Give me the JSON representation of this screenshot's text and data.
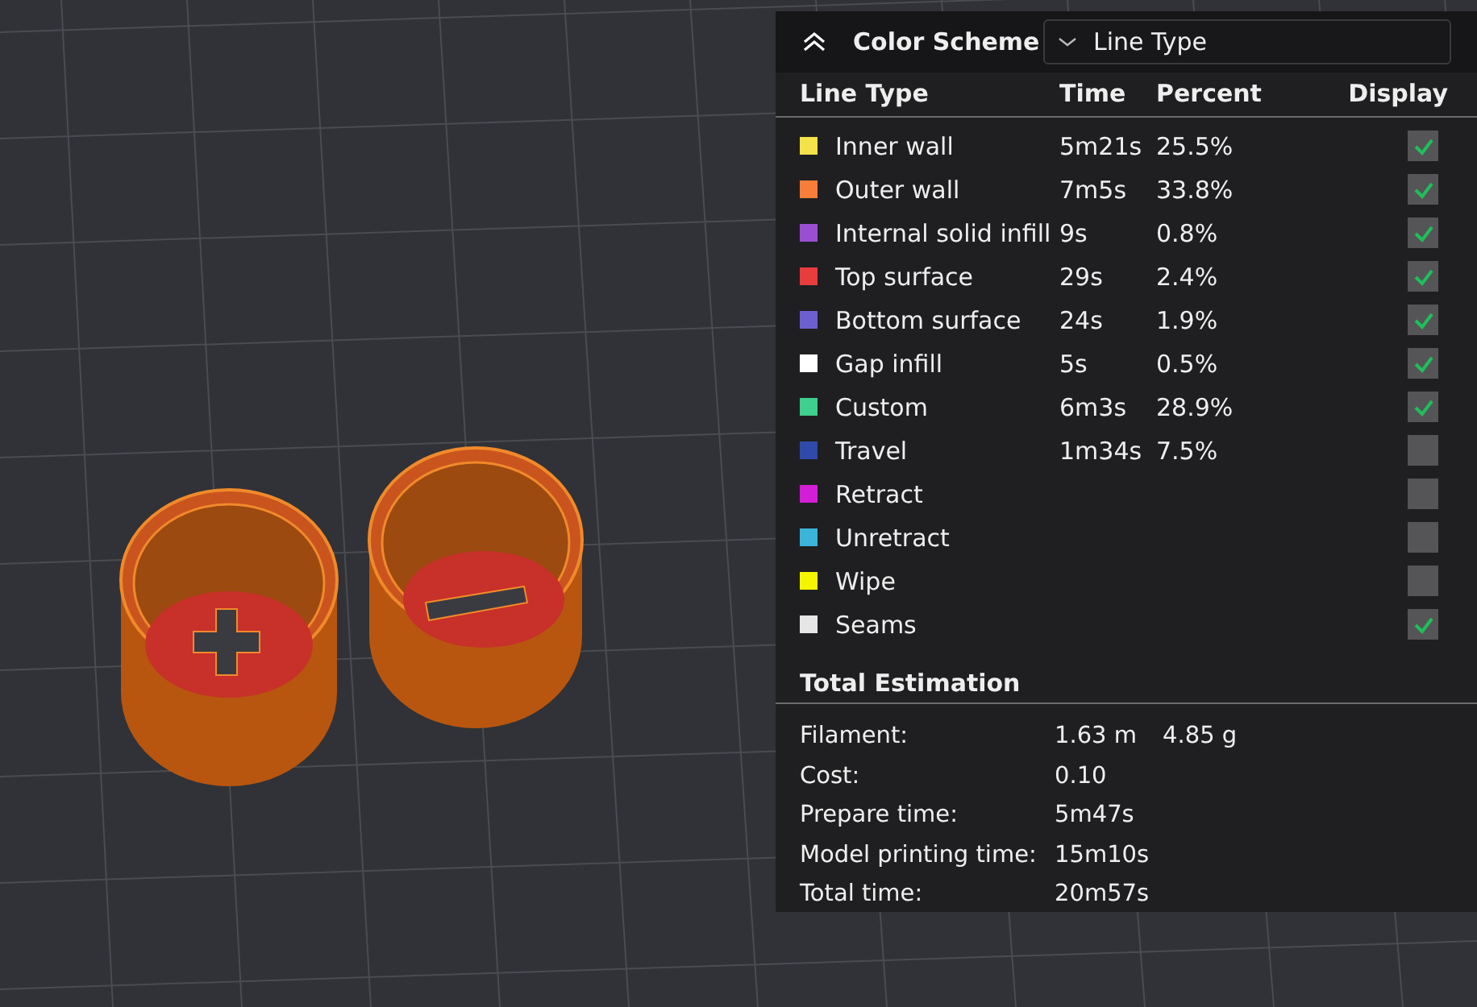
{
  "legend": {
    "title": "Color Scheme",
    "scheme_dropdown": {
      "value": "Line Type"
    },
    "columns": [
      "Line Type",
      "Time",
      "Percent",
      "Display"
    ],
    "rows": [
      {
        "name": "Inner wall",
        "time": "5m21s",
        "percent": "25.5%",
        "color": "#f5e14a",
        "checked": true
      },
      {
        "name": "Outer wall",
        "time": "7m5s",
        "percent": "33.8%",
        "color": "#f47e3a",
        "checked": true
      },
      {
        "name": "Internal solid infill",
        "time": "9s",
        "percent": "0.8%",
        "color": "#9a4fd0",
        "checked": true
      },
      {
        "name": "Top surface",
        "time": "29s",
        "percent": "2.4%",
        "color": "#e83d3d",
        "checked": true
      },
      {
        "name": "Bottom surface",
        "time": "24s",
        "percent": "1.9%",
        "color": "#6d5fd0",
        "checked": true
      },
      {
        "name": "Gap infill",
        "time": "5s",
        "percent": "0.5%",
        "color": "#ffffff",
        "checked": true
      },
      {
        "name": "Custom",
        "time": "6m3s",
        "percent": "28.9%",
        "color": "#3fcf8e",
        "checked": true
      },
      {
        "name": "Travel",
        "time": "1m34s",
        "percent": "7.5%",
        "color": "#2f4aa8",
        "checked": false
      },
      {
        "name": "Retract",
        "color": "#d21fd6",
        "checked": false
      },
      {
        "name": "Unretract",
        "color": "#3cb4d8",
        "checked": false
      },
      {
        "name": "Wipe",
        "color": "#f5f500",
        "checked": false
      },
      {
        "name": "Seams",
        "color": "#e6e6e6",
        "checked": true
      }
    ],
    "estimation": {
      "title": "Total Estimation",
      "rows": [
        {
          "label": "Filament:",
          "values": [
            "1.63 m",
            "4.85 g"
          ]
        },
        {
          "label": "Cost:",
          "values": [
            "0.10"
          ]
        },
        {
          "label": "Prepare time:",
          "values": [
            "5m47s"
          ]
        },
        {
          "label": "Model printing time:",
          "values": [
            "15m10s"
          ]
        },
        {
          "label": "Total time:",
          "values": [
            "20m57s"
          ]
        }
      ]
    }
  }
}
